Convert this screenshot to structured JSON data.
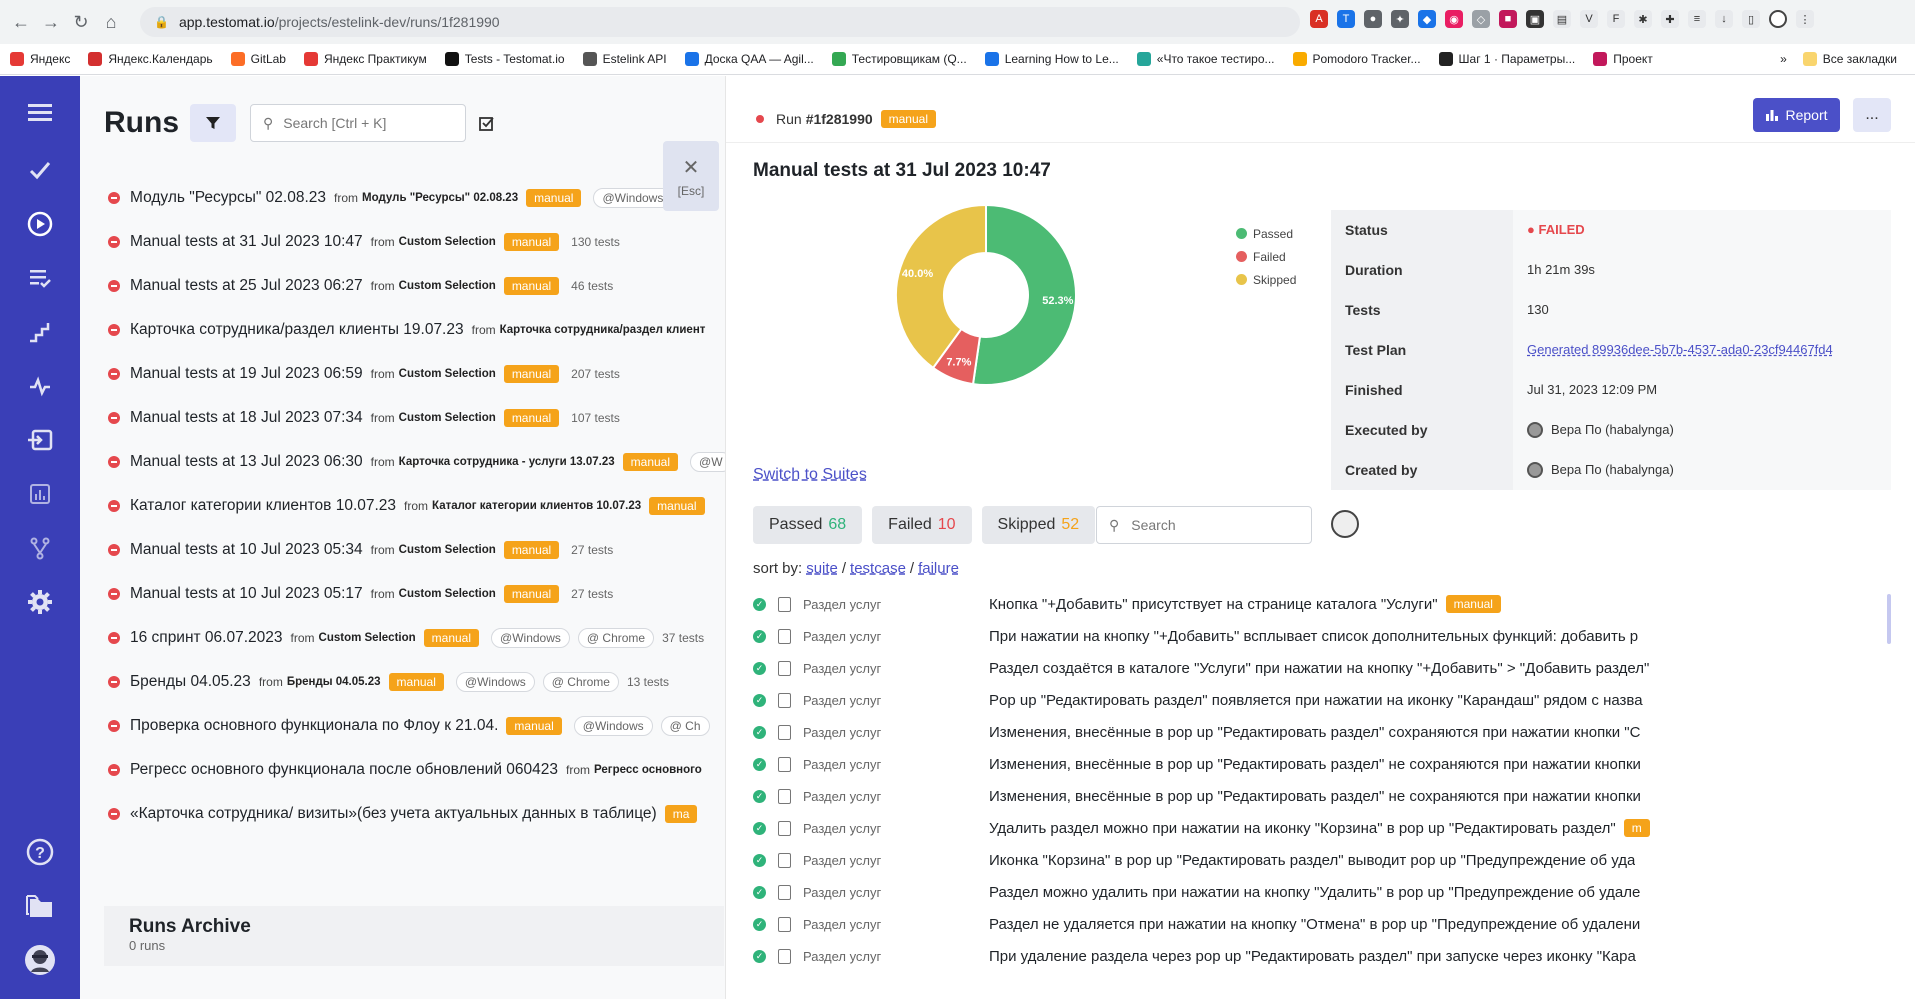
{
  "browser": {
    "url_host": "app.testomat.io",
    "url_path": "/projects/estelink-dev/runs/1f281990",
    "bookmarks": [
      "Яндекс",
      "Яндекс.Календарь",
      "GitLab",
      "Яндекс Практикум",
      "Tests - Testomat.io",
      "Estelink API",
      "Доска QAA — Agil...",
      "Тестировщикам (Q...",
      "Learning How to Le...",
      "«Что такое тестиро...",
      "Pomodoro Tracker...",
      "Шаг 1 · Параметры...",
      "Проект"
    ],
    "bookmarks_more": "»",
    "all_bookmarks": "Все закладки"
  },
  "runs": {
    "title": "Runs",
    "search_placeholder": "Search [Ctrl + K]",
    "esc_label": "[Esc]",
    "items": [
      {
        "name": "Модуль \"Ресурсы\" 02.08.23",
        "from": "from",
        "src": "Модуль \"Ресурсы\" 02.08.23",
        "tag": "manual",
        "env": "@Windows",
        "env2": "",
        "count": ""
      },
      {
        "name": "Manual tests at 31 Jul 2023 10:47",
        "from": "from",
        "src": "Custom Selection",
        "tag": "manual",
        "env": "",
        "env2": "",
        "count": "130 tests"
      },
      {
        "name": "Manual tests at 25 Jul 2023 06:27",
        "from": "from",
        "src": "Custom Selection",
        "tag": "manual",
        "env": "",
        "env2": "",
        "count": "46 tests"
      },
      {
        "name": "Карточка сотрудника/раздел клиенты 19.07.23",
        "from": "from",
        "src": "Карточка сотрудника/раздел клиент",
        "tag": "",
        "env": "",
        "env2": "",
        "count": ""
      },
      {
        "name": "Manual tests at 19 Jul 2023 06:59",
        "from": "from",
        "src": "Custom Selection",
        "tag": "manual",
        "env": "",
        "env2": "",
        "count": "207 tests"
      },
      {
        "name": "Manual tests at 18 Jul 2023 07:34",
        "from": "from",
        "src": "Custom Selection",
        "tag": "manual",
        "env": "",
        "env2": "",
        "count": "107 tests"
      },
      {
        "name": "Manual tests at 13 Jul 2023 06:30",
        "from": "from",
        "src": "Карточка сотрудника - услуги 13.07.23",
        "tag": "manual",
        "env": "@W",
        "env2": "",
        "count": ""
      },
      {
        "name": "Каталог категории клиентов 10.07.23",
        "from": "from",
        "src": "Каталог категории клиентов 10.07.23",
        "tag": "manual",
        "env": "",
        "env2": "",
        "count": ""
      },
      {
        "name": "Manual tests at 10 Jul 2023 05:34",
        "from": "from",
        "src": "Custom Selection",
        "tag": "manual",
        "env": "",
        "env2": "",
        "count": "27 tests"
      },
      {
        "name": "Manual tests at 10 Jul 2023 05:17",
        "from": "from",
        "src": "Custom Selection",
        "tag": "manual",
        "env": "",
        "env2": "",
        "count": "27 tests"
      },
      {
        "name": "16 спринт 06.07.2023",
        "from": "from",
        "src": "Custom Selection",
        "tag": "manual",
        "env": "@Windows",
        "env2": "@ Chrome",
        "count": "37 tests"
      },
      {
        "name": "Бренды 04.05.23",
        "from": "from",
        "src": "Бренды 04.05.23",
        "tag": "manual",
        "env": "@Windows",
        "env2": "@ Chrome",
        "count": "13 tests"
      },
      {
        "name": "Проверка основного функционала по Флоу к 21.04.",
        "from": "",
        "src": "",
        "tag": "manual",
        "env": "@Windows",
        "env2": "@ Ch",
        "count": ""
      },
      {
        "name": "Регресс основного функционала после обновлений 060423",
        "from": "from",
        "src": "Регресс основного",
        "tag": "",
        "env": "",
        "env2": "",
        "count": ""
      },
      {
        "name": "«Карточка сотрудника/ визиты»(без учета актуальных данных в таблице)",
        "from": "",
        "src": "",
        "tag": "ma",
        "env": "",
        "env2": "",
        "count": ""
      }
    ],
    "archive": {
      "title": "Runs Archive",
      "subtitle": "0 runs"
    }
  },
  "detail": {
    "run_label": "Run",
    "run_id": "#1f281990",
    "run_tag": "manual",
    "report_label": "Report",
    "more_label": "...",
    "title": "Manual tests at 31 Jul 2023 10:47",
    "legend": [
      {
        "label": "Passed",
        "color": "#4cbb74"
      },
      {
        "label": "Failed",
        "color": "#e55f5f"
      },
      {
        "label": "Skipped",
        "color": "#e8c44a"
      }
    ],
    "info": [
      {
        "key": "Status",
        "value": "FAILED"
      },
      {
        "key": "Duration",
        "value": "1h 21m 39s"
      },
      {
        "key": "Tests",
        "value": "130"
      },
      {
        "key": "Test Plan",
        "value": "Generated 89936dee-5b7b-4537-ada0-23cf94467fd4"
      },
      {
        "key": "Finished",
        "value": "Jul 31, 2023 12:09 PM"
      },
      {
        "key": "Executed by",
        "value": "Вера По (habalynga)"
      },
      {
        "key": "Created by",
        "value": "Вера По (habalynga)"
      }
    ],
    "switch_label": "Switch to Suites",
    "pills": [
      {
        "label": "Passed",
        "count": "68",
        "color": "#2fb37a"
      },
      {
        "label": "Failed",
        "count": "10",
        "color": "#e5484d"
      },
      {
        "label": "Skipped",
        "count": "52",
        "color": "#f5a31a"
      }
    ],
    "search_placeholder": "Search",
    "sort_label": "sort by:",
    "sort_options": [
      "suite",
      "testcase",
      "failure"
    ],
    "tests": [
      {
        "suite": "Раздел услуг",
        "name": "Кнопка \"+Добавить\" присутствует на странице каталога \"Услуги\"",
        "tag": "manual"
      },
      {
        "suite": "Раздел услуг",
        "name": "При нажатии на кнопку \"+Добавить\" всплывает список дополнительных функций: добавить р",
        "tag": ""
      },
      {
        "suite": "Раздел услуг",
        "name": "Раздел создаётся в каталоге \"Услуги\" при нажатии на кнопку \"+Добавить\" > \"Добавить раздел\"",
        "tag": ""
      },
      {
        "suite": "Раздел услуг",
        "name": "Pop up \"Редактировать раздел\" появляется при нажатии на иконку \"Карандаш\" рядом с назва",
        "tag": ""
      },
      {
        "suite": "Раздел услуг",
        "name": "Изменения, внесённые в pop up \"Редактировать раздел\" сохраняются при нажатии кнопки \"С",
        "tag": ""
      },
      {
        "suite": "Раздел услуг",
        "name": "Изменения, внесённые в pop up \"Редактировать раздел\" не сохраняются при нажатии кнопки",
        "tag": ""
      },
      {
        "suite": "Раздел услуг",
        "name": "Изменения, внесённые в pop up \"Редактировать раздел\" не сохраняются при нажатии кнопки",
        "tag": ""
      },
      {
        "suite": "Раздел услуг",
        "name": "Удалить раздел можно при нажатии на иконку \"Корзина\" в pop up \"Редактировать раздел\"",
        "tag": "m"
      },
      {
        "suite": "Раздел услуг",
        "name": "Иконка \"Корзина\" в pop up \"Редактировать раздел\" выводит pop up \"Предупреждение об уда",
        "tag": ""
      },
      {
        "suite": "Раздел услуг",
        "name": "Раздел можно удалить при нажатии на кнопку \"Удалить\" в pop up \"Предупреждение об удале",
        "tag": ""
      },
      {
        "suite": "Раздел услуг",
        "name": "Раздел не удаляется при нажатии на кнопку \"Отмена\" в pop up \"Предупреждение об удалени",
        "tag": ""
      },
      {
        "suite": "Раздел услуг",
        "name": "При удаление раздела через pop up \"Редактировать раздел\" при запуске через иконку \"Кара",
        "tag": ""
      }
    ]
  },
  "chart_data": {
    "type": "pie",
    "categories": [
      "Passed",
      "Failed",
      "Skipped"
    ],
    "values": [
      52.3,
      7.7,
      40.0
    ],
    "labels": [
      "52.3%",
      "7.7%",
      "40.0%"
    ],
    "colors": [
      "#4cbb74",
      "#e55f5f",
      "#e8c44a"
    ],
    "legend_position": "right"
  }
}
